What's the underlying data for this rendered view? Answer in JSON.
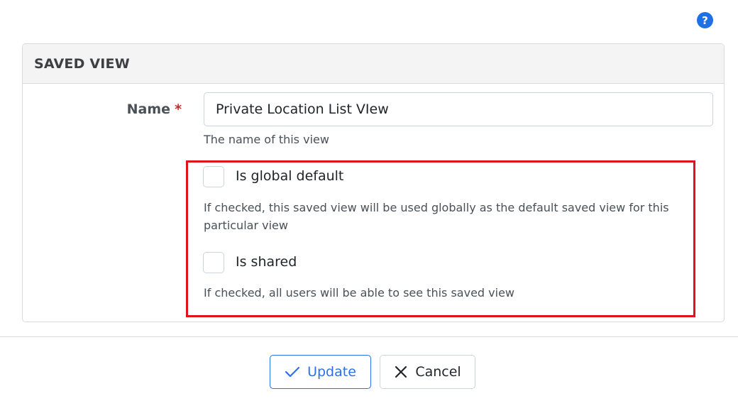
{
  "help_icon": "question-circle-icon",
  "card": {
    "title": "SAVED VIEW"
  },
  "name_field": {
    "label": "Name",
    "required_marker": "*",
    "value": "Private Location List VIew",
    "help": "The name of this view"
  },
  "global_default": {
    "label": "Is global default",
    "checked": false,
    "help": "If checked, this saved view will be used globally as the default saved view for this particular view"
  },
  "shared": {
    "label": "Is shared",
    "checked": false,
    "help": "If checked, all users will be able to see this saved view"
  },
  "buttons": {
    "update_label": "Update",
    "update_icon": "check-icon",
    "cancel_label": "Cancel",
    "cancel_icon": "close-icon"
  },
  "colors": {
    "primary": "#2d6ff0",
    "highlight_border": "#e0121b",
    "required": "#c62828",
    "help_icon_bg": "#1f6fe5"
  }
}
